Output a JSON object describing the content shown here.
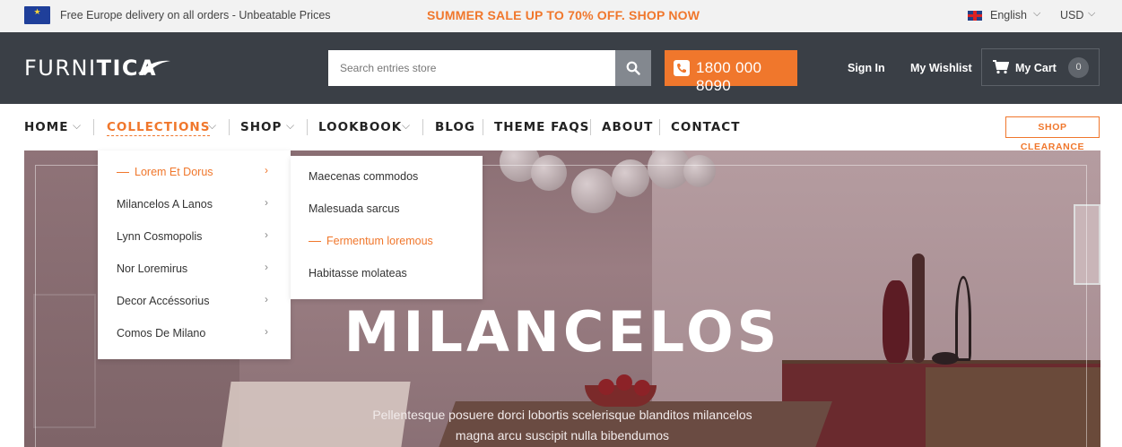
{
  "topbar": {
    "flag_icon": "eu-flag-icon",
    "delivery_text": "Free Europe delivery on all orders - Unbeatable Prices",
    "promo_text": "SUMMER SALE UP TO 70% OFF. SHOP NOW",
    "language": "English",
    "currency": "USD"
  },
  "header": {
    "logo_light": "FURNI",
    "logo_bold": "TICA",
    "search_placeholder": "Search entries store",
    "phone": "1800 000 8090",
    "signin": "Sign In",
    "wishlist": "My Wishlist",
    "cart_label": "My Cart",
    "cart_count": "0"
  },
  "nav": {
    "items": [
      {
        "label": "HOME"
      },
      {
        "label": "COLLECTIONS"
      },
      {
        "label": "SHOP"
      },
      {
        "label": "LOOKBOOK"
      },
      {
        "label": "BLOG"
      },
      {
        "label": "THEME FAQS"
      },
      {
        "label": "ABOUT"
      },
      {
        "label": "CONTACT"
      }
    ],
    "clearance": "SHOP CLEARANCE"
  },
  "collections_menu": {
    "items": [
      {
        "label": "Lorem Et Dorus"
      },
      {
        "label": "Milancelos A Lanos"
      },
      {
        "label": "Lynn Cosmopolis"
      },
      {
        "label": "Nor Loremirus"
      },
      {
        "label": "Decor Accéssorius"
      },
      {
        "label": "Comos De Milano"
      }
    ]
  },
  "submenu": {
    "items": [
      {
        "label": "Maecenas commodos"
      },
      {
        "label": "Malesuada sarcus"
      },
      {
        "label": "Fermentum loremous"
      },
      {
        "label": "Habitasse molateas"
      }
    ]
  },
  "hero": {
    "title": "MILANCELOS",
    "subtitle_line1": "Pellentesque posuere dorci lobortis scelerisque blanditos milancelos",
    "subtitle_line2": "magna arcu suscipit nulla bibendumos"
  },
  "colors": {
    "accent": "#f0772c",
    "header_bg": "#3a3f46",
    "topbar_bg": "#f2f2f2"
  }
}
